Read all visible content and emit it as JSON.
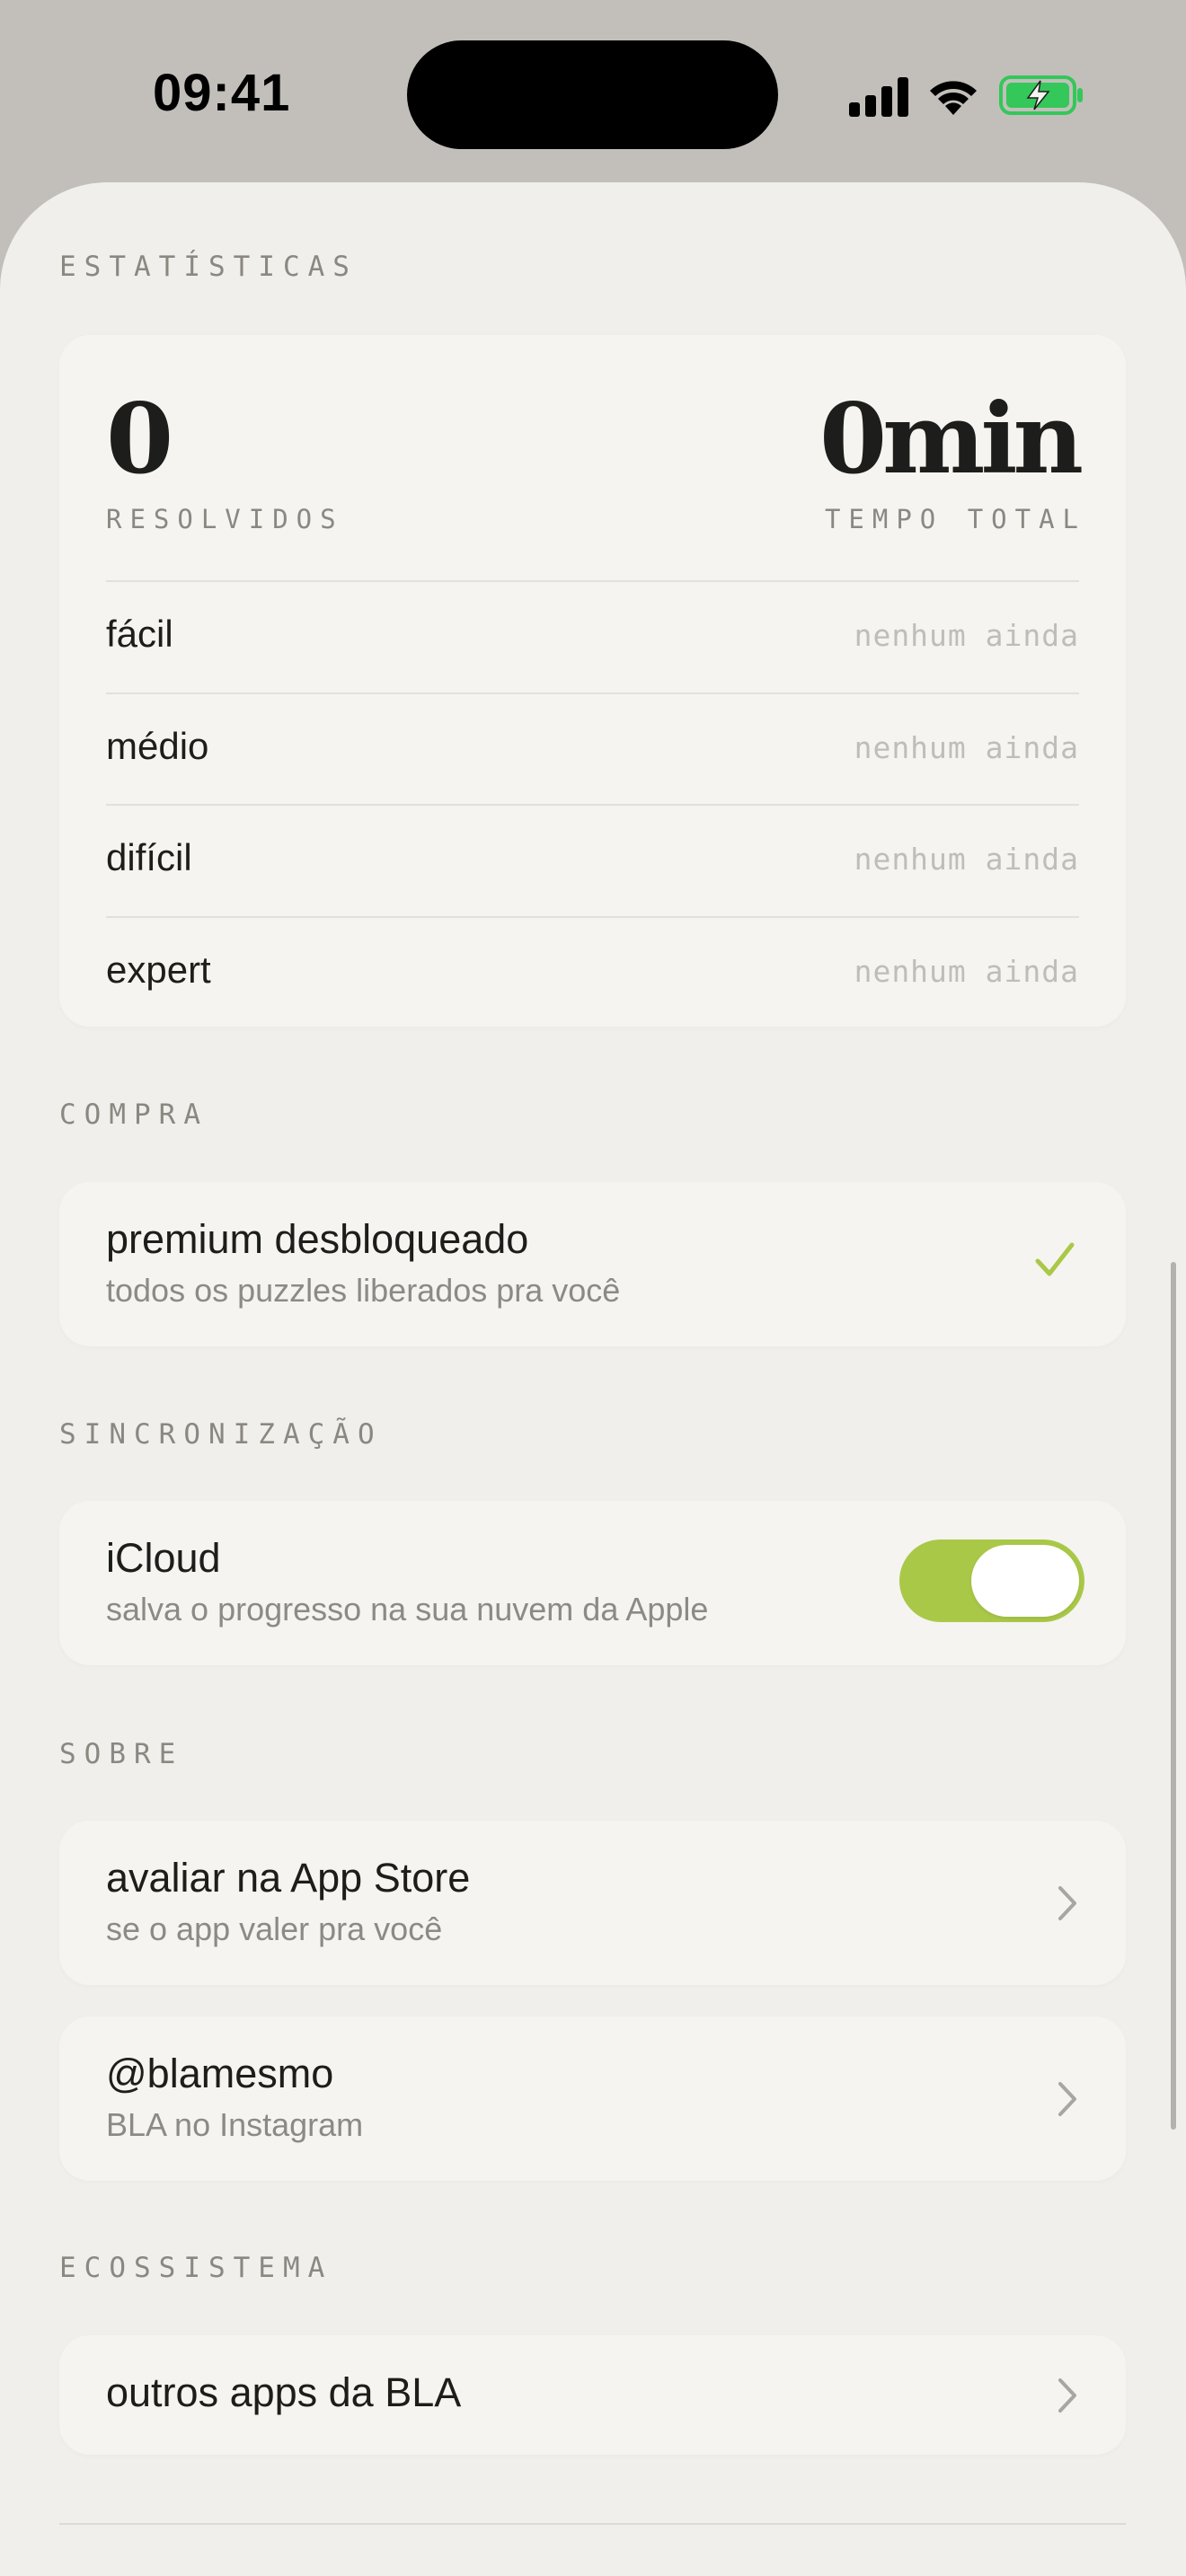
{
  "status_bar": {
    "time": "09:41"
  },
  "sections": {
    "stats": "ESTATÍSTICAS",
    "purchase": "COMPRA",
    "sync": "SINCRONIZAÇÃO",
    "about": "SOBRE",
    "ecosystem": "ECOSSISTEMA"
  },
  "stats": {
    "solved_value": "0",
    "solved_label": "RESOLVIDOS",
    "total_time_value": "0min",
    "total_time_label": "TEMPO TOTAL",
    "difficulties": [
      {
        "name": "fácil",
        "value": "nenhum ainda"
      },
      {
        "name": "médio",
        "value": "nenhum ainda"
      },
      {
        "name": "difícil",
        "value": "nenhum ainda"
      },
      {
        "name": "expert",
        "value": "nenhum ainda"
      }
    ]
  },
  "purchase": {
    "title": "premium desbloqueado",
    "subtitle": "todos os puzzles liberados pra você",
    "icon": "checkmark-icon"
  },
  "sync": {
    "title": "iCloud",
    "subtitle": "salva o progresso na sua nuvem da Apple",
    "enabled": true
  },
  "about": {
    "rate": {
      "title": "avaliar na App Store",
      "subtitle": "se o app valer pra você"
    },
    "instagram": {
      "title": "@blamesmo",
      "subtitle": "BLA no Instagram"
    }
  },
  "ecosystem": {
    "title": "outros apps da BLA"
  },
  "colors": {
    "accent": "#aac848",
    "background": "#f1efeb",
    "card": "#f5f4f0",
    "label_muted": "#8b8882",
    "battery_green": "#34c759"
  }
}
